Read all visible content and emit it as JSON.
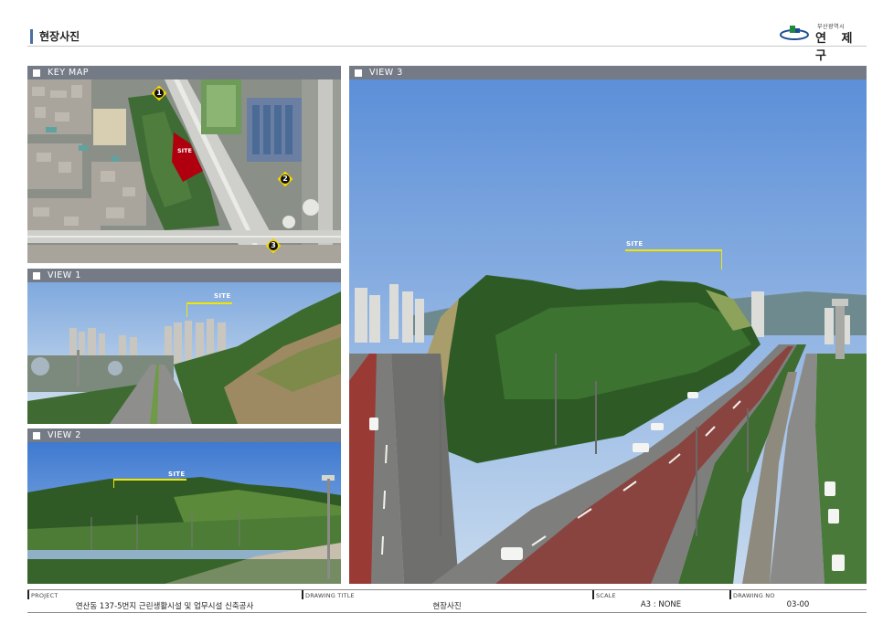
{
  "header": {
    "title": "현장사진"
  },
  "logo": {
    "small_text": "부산광역시",
    "main_text": "연 제 구",
    "brand_color": "#1d8a3c",
    "accent_color": "#1a4c97"
  },
  "panels": {
    "keymap": {
      "label": "KEY MAP",
      "site_label": "SITE",
      "markers": [
        "1",
        "2",
        "3"
      ]
    },
    "view1": {
      "label": "VIEW 1",
      "site_label": "SITE"
    },
    "view2": {
      "label": "VIEW 2",
      "site_label": "SITE"
    },
    "view3": {
      "label": "VIEW 3",
      "site_label": "SITE"
    }
  },
  "footer": {
    "project_label": "PROJECT",
    "project_value": "연산동 137-5번지 근린생활시설 및 업무시설 신축공사",
    "drawing_title_label": "DRAWING TITLE",
    "drawing_title_value": "현장사진",
    "scale_label": "SCALE",
    "scale_value": "A3 : NONE",
    "drawing_no_label": "DRAWING NO",
    "drawing_no_value": "03-00"
  },
  "colors": {
    "panel_header": "#757b86",
    "site_marker": "#f2e600",
    "site_polygon": "#b00010"
  }
}
